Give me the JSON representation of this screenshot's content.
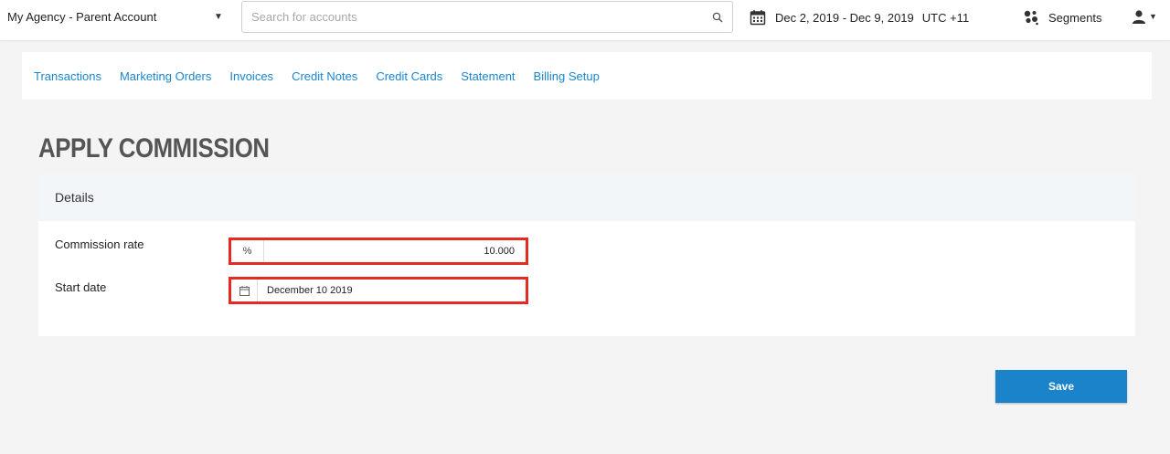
{
  "topbar": {
    "account_name": "My Agency - Parent Account",
    "search_placeholder": "Search for accounts",
    "date_range": "Dec 2, 2019 - Dec 9, 2019",
    "timezone": "UTC +11",
    "segments_label": "Segments"
  },
  "tabs": [
    {
      "label": "Transactions"
    },
    {
      "label": "Marketing Orders"
    },
    {
      "label": "Invoices"
    },
    {
      "label": "Credit Notes"
    },
    {
      "label": "Credit Cards"
    },
    {
      "label": "Statement"
    },
    {
      "label": "Billing Setup"
    }
  ],
  "page": {
    "title": "APPLY COMMISSION"
  },
  "details": {
    "header": "Details",
    "commission_rate_label": "Commission rate",
    "commission_rate_addon": "%",
    "commission_rate_value": "10.000",
    "start_date_label": "Start date",
    "start_date_value": "December 10 2019"
  },
  "actions": {
    "save_label": "Save"
  },
  "colors": {
    "link": "#1a86d0",
    "primary_button": "#1a83c9",
    "highlight_border": "#e52a23"
  }
}
